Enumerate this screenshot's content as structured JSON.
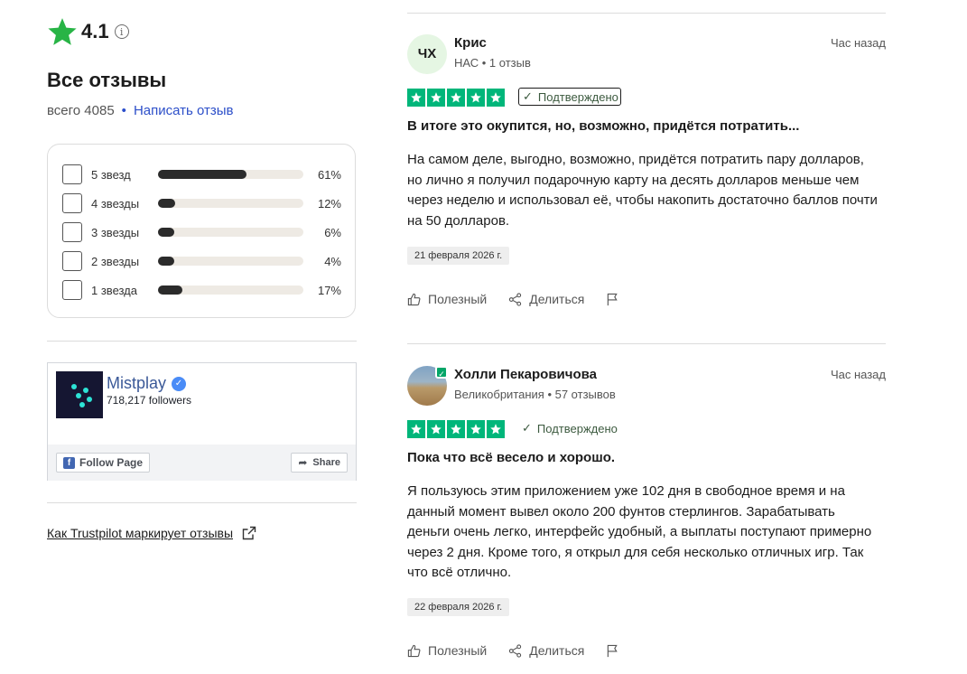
{
  "summary": {
    "rating": "4.1",
    "title": "Все отзывы",
    "total_label": "всего 4085",
    "separator": "•",
    "write_review": "Написать отзыв",
    "star_color": "#28b446"
  },
  "distribution": [
    {
      "label": "5 звезд",
      "percent_text": "61%",
      "fraction": 0.61
    },
    {
      "label": "4 звезды",
      "percent_text": "12%",
      "fraction": 0.12
    },
    {
      "label": "3 звезды",
      "percent_text": "6%",
      "fraction": 0.06
    },
    {
      "label": "2 звезды",
      "percent_text": "4%",
      "fraction": 0.04
    },
    {
      "label": "1 звезда",
      "percent_text": "17%",
      "fraction": 0.17
    }
  ],
  "facebook_widget": {
    "page_name": "Mistplay",
    "followers": "718,217 followers",
    "follow_label": "Follow Page",
    "share_label": "Share"
  },
  "how_link": "Как Trustpilot маркирует отзывы",
  "reviews": [
    {
      "initials": "ЧХ",
      "name": "Крис",
      "meta": "НАС • 1 отзыв",
      "time": "Час назад",
      "stars": 5,
      "verified": "Подтверждено",
      "title": "В итоге это окупится, но, возможно, придётся потратить...",
      "body": "На самом деле, выгодно, возможно, придётся потратить пару долларов, но лично я получил подарочную карту на десять долларов меньше чем через неделю и использовал её, чтобы накопить достаточно баллов почти на 50 долларов.",
      "date": "21 февраля 2026 г.",
      "useful": "Полезный",
      "share": "Делиться"
    },
    {
      "name": "Холли Пекаровичова",
      "meta": "Великобритания • 57 отзывов",
      "time": "Час назад",
      "stars": 5,
      "verified": "Подтверждено",
      "title": "Пока что всё весело и хорошо.",
      "body": "Я пользуюсь этим приложением уже 102 дня в свободное время и на данный момент вывел около 200 фунтов стерлингов. Зарабатывать деньги очень легко, интерфейс удобный, а выплаты поступают примерно через 2 дня. Кроме того, я открыл для себя несколько отличных игр. Так что всё отлично.",
      "date": "22 февраля 2026 г.",
      "useful": "Полезный",
      "share": "Делиться"
    }
  ],
  "colors": {
    "trustpilot_green": "#00b67a",
    "bar_fill": "#2b2b2b",
    "link_blue": "#2c4fc9",
    "facebook_blue": "#3b5998"
  }
}
